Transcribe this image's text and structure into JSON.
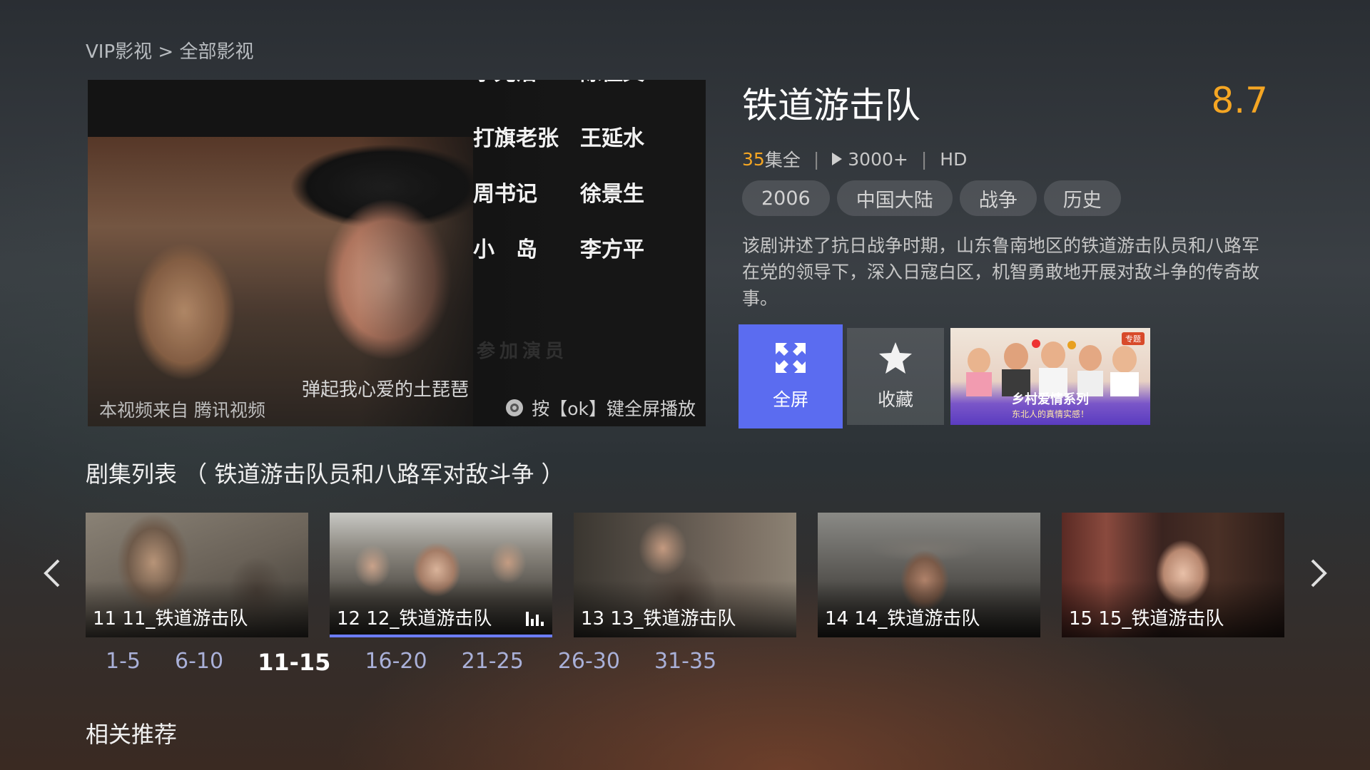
{
  "breadcrumb": "VIP影视 > 全部影视",
  "player": {
    "credits": [
      {
        "role": "李光洁",
        "actor": "陈佳文"
      },
      {
        "role": "打旗老张",
        "actor": "王延水"
      },
      {
        "role": "周书记",
        "actor": "徐景生"
      },
      {
        "role": "小　岛",
        "actor": "李方平"
      }
    ],
    "ghost_text": "参加演员",
    "subtitle": "弹起我心爱的土琵琶",
    "source_text": "本视频来自 腾讯视频",
    "fullscreen_hint": "按【ok】键全屏播放"
  },
  "show": {
    "title": "铁道游击队",
    "score": "8.7",
    "episode_count": "35",
    "episode_suffix": "集全",
    "plays": "3000+",
    "quality": "HD",
    "tags": [
      "2006",
      "中国大陆",
      "战争",
      "历史"
    ],
    "description": "该剧讲述了抗日战争时期，山东鲁南地区的铁道游击队员和八路军在党的领导下，深入日寇白区，机智勇敢地开展对敌斗争的传奇故事。"
  },
  "actions": {
    "fullscreen_label": "全屏",
    "favorite_label": "收藏"
  },
  "promo": {
    "badge": "专题",
    "title": "乡村爱情系列",
    "subtitle": "东北人的真情实感！"
  },
  "episodes_section_title": "剧集列表 （ 铁道游击队员和八路军对敌斗争 ）",
  "episodes": [
    {
      "label": "11 11_铁道游击队",
      "playing": false
    },
    {
      "label": "12 12_铁道游击队",
      "playing": true
    },
    {
      "label": "13 13_铁道游击队",
      "playing": false
    },
    {
      "label": "14 14_铁道游击队",
      "playing": false
    },
    {
      "label": "15 15_铁道游击队",
      "playing": false
    }
  ],
  "ranges": [
    "1-5",
    "6-10",
    "11-15",
    "16-20",
    "21-25",
    "26-30",
    "31-35"
  ],
  "active_range": "11-15",
  "related_title": "相关推荐",
  "colors": {
    "accent": "#5b6cf0",
    "score": "#f5a623",
    "progress": "#6b7cff"
  }
}
